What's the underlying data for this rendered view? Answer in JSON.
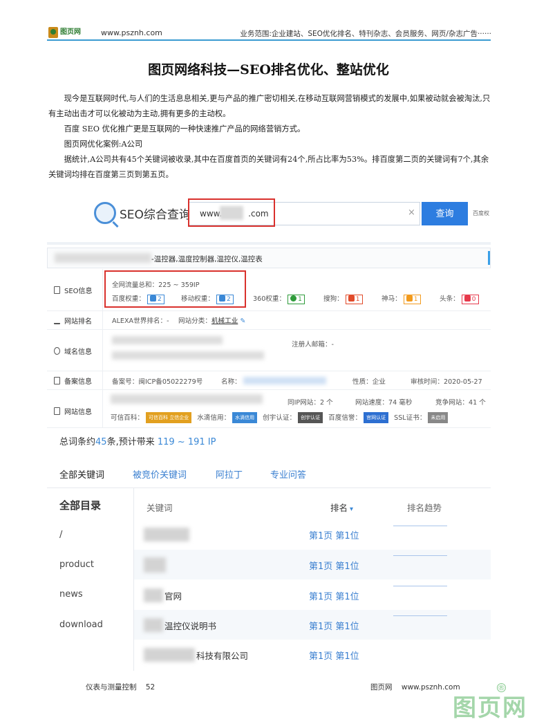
{
  "header": {
    "logo_text": "图页网",
    "site": "www.psznh.com",
    "scope": "业务范围:企业建站、SEO优化排名、特刊杂志、会员服务、网页/杂志广告······"
  },
  "title": "图页网络科技—SEO排名优化、整站优化",
  "paragraphs": [
    "现今是互联网时代,与人们的生活息息相关,更与产品的推广密切相关,在移动互联网营销模式的发展中,如果被动就会被淘汰,只有主动出击才可以化被动为主动,拥有更多的主动权。",
    "百度 SEO 优化推广更是互联网的一种快速推广产品的网络营销方式。",
    "图页网优化案例:A公司",
    "据统计,A公司共有45个关键词被收录,其中在百度首页的关键词有24个,所占比率为53%。排百度第二页的关键词有7个,其余关键词均排在百度第三页到第五页。"
  ],
  "search": {
    "brand": "SEO综合查询",
    "value_prefix": "www.",
    "value_suffix": ".com",
    "clear": "×",
    "button": "查询",
    "extra": "百度权"
  },
  "site_row": {
    "keywords": "-温控器,温度控制器,温控仪,温控表"
  },
  "seo": {
    "label": "SEO信息",
    "traffic": "全网流量总和：225 ~ 359IP",
    "baidu_label": "百度权重：",
    "baidu_val": "2",
    "mobile_label": "移动权重：",
    "mobile_val": "2",
    "q360_label": "360权重：",
    "q360_val": "1",
    "sogou_label": "搜狗：",
    "sogou_val": "1",
    "shenma_label": "神马：",
    "shenma_val": "1",
    "toutiao_label": "头条：",
    "toutiao_val": "0"
  },
  "rank": {
    "label": "网站排名",
    "alexa": "ALEXA世界排名：-",
    "category_label": "网站分类：",
    "category": "机械工业"
  },
  "domain": {
    "label": "域名信息",
    "email": "注册人邮箱：-"
  },
  "beian": {
    "label": "备案信息",
    "no": "备案号：闽ICP备05022279号",
    "name_label": "名称：",
    "nature": "性质：企业",
    "audit": "审核时间：2020-05-27"
  },
  "siteinfo": {
    "label": "网站信息",
    "ip_sites": "同IP网站：2 个",
    "speed": "网站速度：74 毫秒",
    "compete": "竞争网站：41 个",
    "kexin_label": "可信百科：",
    "kexin_badge": "可信百科 立信企业",
    "shuidi_label": "水滴信用：",
    "shuidi_badge": "水滴信用",
    "chuangyu_label": "创宇认证：",
    "chuangyu_badge": "创宇认证",
    "baidu_label": "百度信誉：",
    "baidu_badge": "官网认证",
    "ssl_label": "SSL证书：",
    "ssl_badge": "未启用"
  },
  "summary": {
    "prefix": "总词条约",
    "count": "45",
    "mid": "条,预计带来",
    "range": "119 ~ 191 IP"
  },
  "tabs": [
    "全部关键词",
    "被竞价关键词",
    "阿拉丁",
    "专业问答"
  ],
  "tree": {
    "title": "全部目录",
    "items": [
      "/",
      "product",
      "news",
      "download"
    ]
  },
  "table": {
    "headers": [
      "关键词",
      "排名",
      "排名趋势"
    ],
    "sort_arrow": "▾",
    "rows": [
      {
        "keyword": "",
        "rank": "第1页 第1位"
      },
      {
        "keyword": "",
        "rank": "第1页 第1位"
      },
      {
        "keyword": "官网",
        "rank": "第1页 第1位"
      },
      {
        "keyword": "温控仪说明书",
        "rank": "第1页 第1位"
      },
      {
        "keyword": "科技有限公司",
        "rank": "第1页 第1位"
      }
    ]
  },
  "footer": {
    "left": "仪表与测量控制    52",
    "right": "图页网    www.psznh.com",
    "watermark": "图页网",
    "registered": "®"
  },
  "colors": {
    "accent": "#3a88d6",
    "highlight": "#d9302c",
    "rule": "#3a9bd1"
  }
}
